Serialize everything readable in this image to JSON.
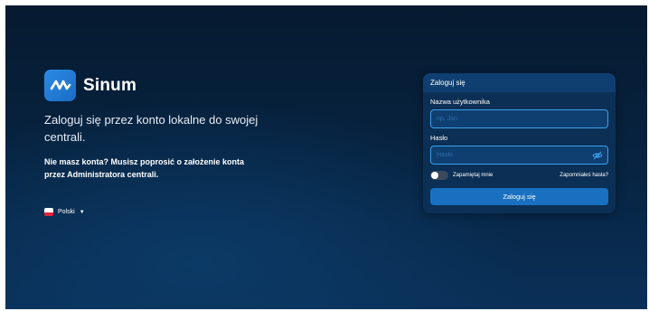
{
  "brand": {
    "name": "Sinum"
  },
  "intro": {
    "headline": "Zaloguj się przez konto lokalne do swojej centrali.",
    "no_account": "Nie masz konta? Musisz poprosić o założenie konta przez Administratora centrali."
  },
  "language": {
    "selected": "Polski",
    "icon": "poland-flag-icon"
  },
  "login": {
    "header": "Zaloguj się",
    "username_label": "Nazwa użytkownika",
    "username_placeholder": "np. Jan",
    "username_value": "",
    "password_label": "Hasło",
    "password_placeholder": "Hasło",
    "password_value": "",
    "remember_label": "Zapamiętaj mnie",
    "remember_checked": false,
    "forgot_label": "Zapomniałeś hasła?",
    "submit_label": "Zaloguj się"
  },
  "colors": {
    "accent": "#1a70c0",
    "field_border": "#3aa0ef",
    "background": "#072442"
  }
}
